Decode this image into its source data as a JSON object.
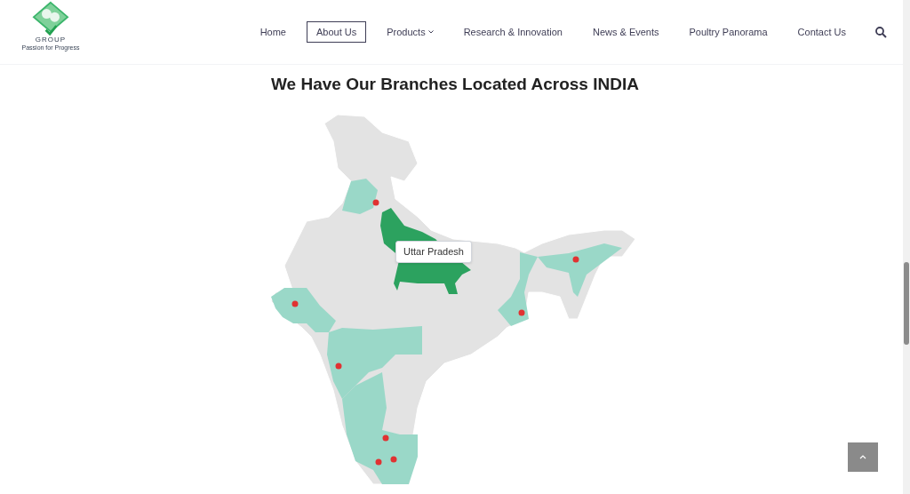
{
  "logo": {
    "group": "GROUP",
    "tagline": "Passion for Progress"
  },
  "nav": [
    {
      "label": "Home",
      "selected": false,
      "dropdown": false
    },
    {
      "label": "About Us",
      "selected": true,
      "dropdown": false
    },
    {
      "label": "Products",
      "selected": false,
      "dropdown": true
    },
    {
      "label": "Research & Innovation",
      "selected": false,
      "dropdown": false
    },
    {
      "label": "News & Events",
      "selected": false,
      "dropdown": false
    },
    {
      "label": "Poultry Panorama",
      "selected": false,
      "dropdown": false
    },
    {
      "label": "Contact Us",
      "selected": false,
      "dropdown": false
    }
  ],
  "heading": "We Have Our Branches Located Across INDIA",
  "map": {
    "tooltip": "Uttar Pradesh"
  }
}
